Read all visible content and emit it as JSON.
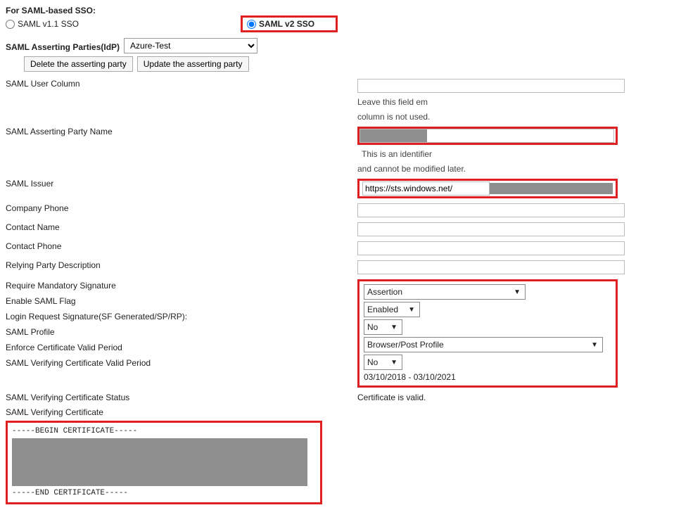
{
  "header": {
    "title": "For SAML-based SSO:",
    "radio_v1": "SAML v1.1 SSO",
    "radio_v2": "SAML v2 SSO"
  },
  "asserting": {
    "label": "SAML Asserting Parties(IdP)",
    "selected": "Azure-Test",
    "btn_delete": "Delete the asserting party",
    "btn_update": "Update the asserting party"
  },
  "fields": {
    "user_column": {
      "label": "SAML User Column",
      "value": "",
      "help_right": "Leave this field em",
      "help_below": "column is not used."
    },
    "party_name": {
      "label": "SAML Asserting Party Name",
      "help_right": "This is an identifier",
      "help_below": "and cannot be modified later."
    },
    "issuer": {
      "label": "SAML Issuer",
      "value": "https://sts.windows.net/"
    },
    "company_phone": {
      "label": "Company Phone",
      "value": ""
    },
    "contact_name": {
      "label": "Contact Name",
      "value": ""
    },
    "contact_phone": {
      "label": "Contact Phone",
      "value": ""
    },
    "relying_desc": {
      "label": "Relying Party Description",
      "value": ""
    },
    "req_sig": {
      "label": "Require Mandatory Signature",
      "value": "Assertion"
    },
    "enable_flag": {
      "label": "Enable SAML Flag",
      "value": "Enabled"
    },
    "login_sig": {
      "label": "Login Request Signature(SF Generated/SP/RP):",
      "value": "No"
    },
    "saml_profile": {
      "label": "SAML Profile",
      "value": "Browser/Post Profile"
    },
    "enforce_period": {
      "label": "Enforce Certificate Valid Period",
      "value": "No"
    },
    "cert_period": {
      "label": "SAML Verifying Certificate Valid Period",
      "value": "03/10/2018 - 03/10/2021"
    },
    "cert_status": {
      "label": "SAML Verifying Certificate Status",
      "value": "Certificate is valid."
    },
    "cert": {
      "label": "SAML Verifying Certificate",
      "begin": "-----BEGIN CERTIFICATE-----",
      "end": "-----END CERTIFICATE-----"
    }
  }
}
